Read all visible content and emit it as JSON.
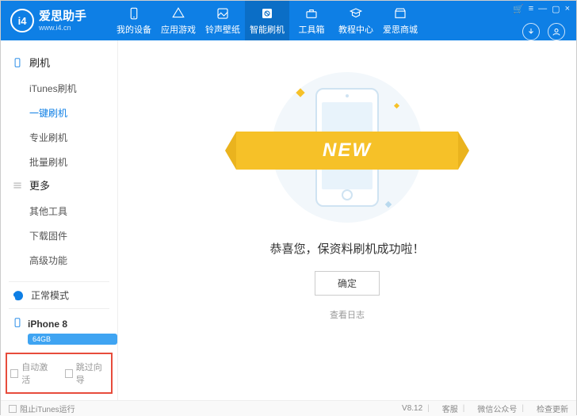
{
  "logo": {
    "badge": "i4",
    "title": "爱思助手",
    "subtitle": "www.i4.cn"
  },
  "nav": [
    {
      "label": "我的设备"
    },
    {
      "label": "应用游戏"
    },
    {
      "label": "铃声壁纸"
    },
    {
      "label": "智能刷机"
    },
    {
      "label": "工具箱"
    },
    {
      "label": "教程中心"
    },
    {
      "label": "爱思商城"
    }
  ],
  "sidebar": {
    "group1": {
      "head": "刷机",
      "items": [
        "iTunes刷机",
        "一键刷机",
        "专业刷机",
        "批量刷机"
      ]
    },
    "group2": {
      "head": "更多",
      "items": [
        "其他工具",
        "下载固件",
        "高级功能"
      ]
    },
    "mode": "正常模式",
    "device": "iPhone 8",
    "storage": "64GB",
    "check1": "自动激活",
    "check2": "跳过向导"
  },
  "main": {
    "ribbon": "NEW",
    "success": "恭喜您，保资料刷机成功啦！",
    "confirm": "确定",
    "log": "查看日志"
  },
  "footer": {
    "blockItunes": "阻止iTunes运行",
    "version": "V8.12",
    "support": "客服",
    "wechat": "微信公众号",
    "update": "检查更新"
  }
}
